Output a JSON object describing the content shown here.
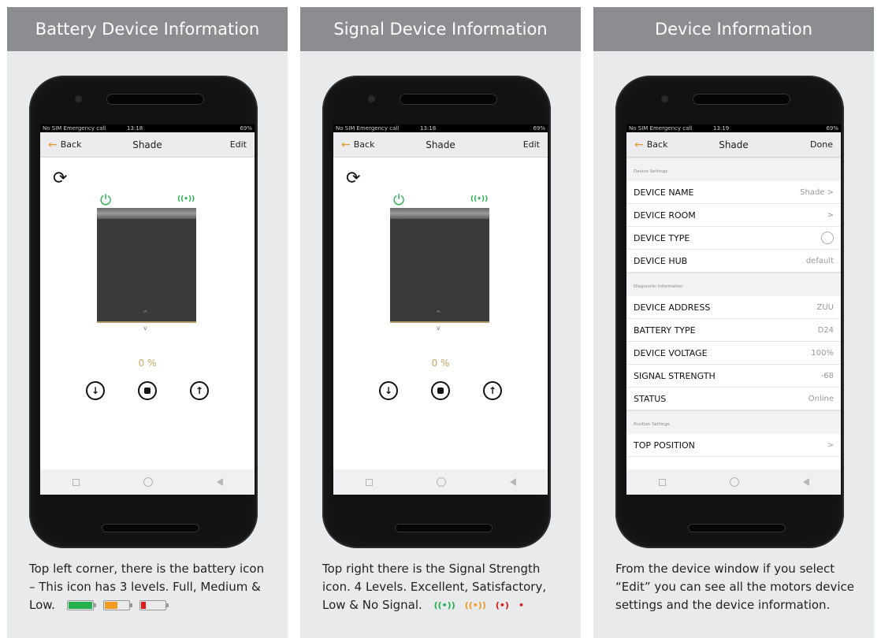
{
  "colors": {
    "header_bg": "#8c8d90",
    "panel_bg": "#e9eaec",
    "green": "#22b04b",
    "orange": "#f29a1f",
    "red": "#e01818",
    "accent_back": "#e39a2c",
    "percent": "#c9a65e"
  },
  "panels": [
    {
      "header": "Battery Device Information",
      "caption": "Top left corner, there is the battery icon – This icon has 3 levels. Full, Medium & Low.",
      "phone": {
        "status_left": "No SIM  Emergency call  ",
        "status_time": "13:18",
        "status_right": "69%",
        "back": "Back",
        "title": "Shade",
        "action": "Edit",
        "percent": "0 %"
      },
      "battery_levels": [
        {
          "name": "full-battery-icon",
          "fill": 1.0,
          "color": "#22b04b"
        },
        {
          "name": "medium-battery-icon",
          "fill": 0.5,
          "color": "#f29a1f"
        },
        {
          "name": "low-battery-icon",
          "fill": 0.2,
          "color": "#e01818"
        }
      ]
    },
    {
      "header": "Signal Device Information",
      "caption": "Top right there is the Signal Strength icon. 4 Levels. Excellent, Satisfactory, Low & No Signal.",
      "phone": {
        "status_left": "No SIM  Emergency call  ",
        "status_time": "13:18",
        "status_right": "69%",
        "back": "Back",
        "title": "Shade",
        "action": "Edit",
        "percent": "0 %"
      }
    },
    {
      "header": "Device Information",
      "caption": "From the device window if you select “Edit” you can see all the motors device settings and the device information.",
      "phone": {
        "status_left": "No SIM  Emergency call  ",
        "status_time": "13:19",
        "status_right": "69%",
        "back": "Back",
        "title": "Shade",
        "action": "Done"
      },
      "sections": {
        "device_settings": "Device Settings",
        "diagnostic": "Diagnostic Information",
        "position": "Position Settings"
      },
      "rows": {
        "device_name": {
          "label": "DEVICE NAME",
          "value": "Shade  >"
        },
        "device_room": {
          "label": "DEVICE ROOM",
          "value": ">"
        },
        "device_type": {
          "label": "DEVICE TYPE"
        },
        "device_hub": {
          "label": "DEVICE HUB",
          "value": "default"
        },
        "device_address": {
          "label": "DEVICE ADDRESS",
          "value": "ZUU"
        },
        "battery_type": {
          "label": "BATTERY TYPE",
          "value": "D24"
        },
        "device_voltage": {
          "label": "DEVICE VOLTAGE",
          "value": "100%"
        },
        "signal_strength": {
          "label": "SIGNAL STRENGTH",
          "value": "-68"
        },
        "status": {
          "label": "STATUS",
          "value": "Online"
        },
        "top_position": {
          "label": "TOP POSITION",
          "value": ">"
        }
      }
    }
  ]
}
